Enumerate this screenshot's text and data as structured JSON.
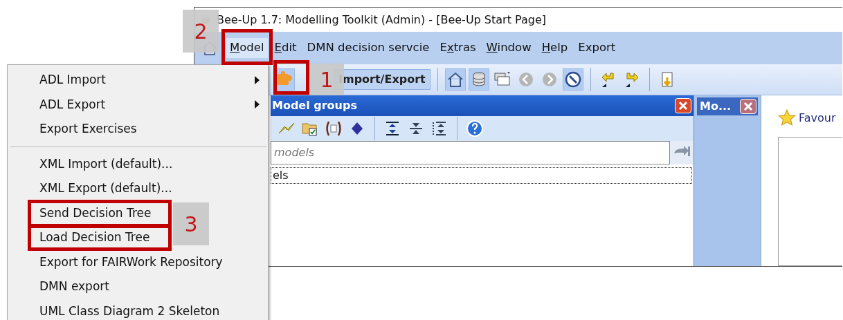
{
  "window": {
    "title": "Bee-Up 1.7: Modelling Toolkit (Admin) - [Bee-Up Start Page]"
  },
  "menubar": [
    {
      "key": "M",
      "post": "odel",
      "selected": true
    },
    {
      "key": "E",
      "post": "dit",
      "selected": false
    },
    {
      "pre": "DMN decision servcie",
      "selected": false
    },
    {
      "pre": "E",
      "key": "x",
      "post": "tras",
      "selected": false
    },
    {
      "key": "W",
      "post": "indow",
      "selected": false
    },
    {
      "key": "H",
      "post": "elp",
      "selected": false
    },
    {
      "pre": "Export",
      "selected": false
    }
  ],
  "toolbar": {
    "button": "Import/Export"
  },
  "model_groups_panel": {
    "title": "Model groups",
    "search": {
      "placeholder": "models"
    },
    "tree": [
      {
        "label": "els",
        "selected": true
      }
    ]
  },
  "second_panel": {
    "title": "Mo..."
  },
  "start_page": {
    "favourites": "Favour"
  },
  "context_menu": [
    {
      "kind": "submenu",
      "label": "ADL Import"
    },
    {
      "kind": "submenu",
      "label": "ADL Export"
    },
    {
      "kind": "item",
      "label": "Export Exercises"
    },
    {
      "kind": "separator"
    },
    {
      "kind": "item",
      "label": "XML Import (default)..."
    },
    {
      "kind": "item",
      "label": "XML Export (default)..."
    },
    {
      "kind": "item",
      "label": "Send Decision Tree"
    },
    {
      "kind": "item",
      "label": "Load Decision Tree"
    },
    {
      "kind": "item",
      "label": "Export for FAIRWork Repository"
    },
    {
      "kind": "item",
      "label": "DMN export"
    },
    {
      "kind": "item",
      "label": "UML Class Diagram 2 Skeleton"
    }
  ],
  "callouts": [
    {
      "label": "2"
    },
    {
      "label": "1"
    },
    {
      "label": "3"
    }
  ]
}
